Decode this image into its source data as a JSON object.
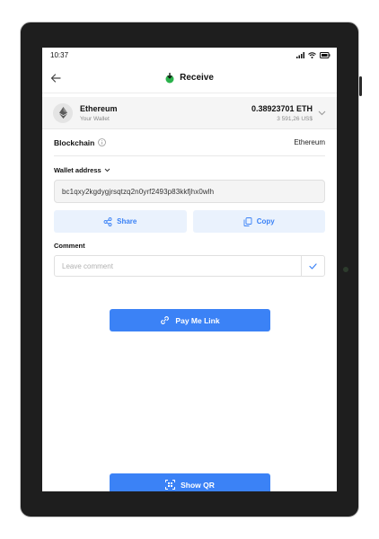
{
  "status_bar": {
    "time": "10:37"
  },
  "header": {
    "title": "Receive"
  },
  "asset": {
    "name": "Ethereum",
    "subtitle": "Your Wallet",
    "balance": "0.38923701 ETH",
    "fiat_value": "3 591,26 US$"
  },
  "blockchain": {
    "label": "Blockchain",
    "value": "Ethereum"
  },
  "wallet": {
    "label": "Wallet address",
    "address": "bc1qxy2kgdygjrsqtzq2n0yrf2493p83kkfjhx0wlh"
  },
  "actions": {
    "share_label": "Share",
    "copy_label": "Copy"
  },
  "comment": {
    "label": "Comment",
    "placeholder": "Leave comment",
    "value": ""
  },
  "pay_link_label": "Pay Me Link",
  "show_qr_label": "Show QR",
  "colors": {
    "accent": "#3b82f6",
    "accent_light": "#eaf2fd",
    "app_icon": "#2bb24c"
  }
}
